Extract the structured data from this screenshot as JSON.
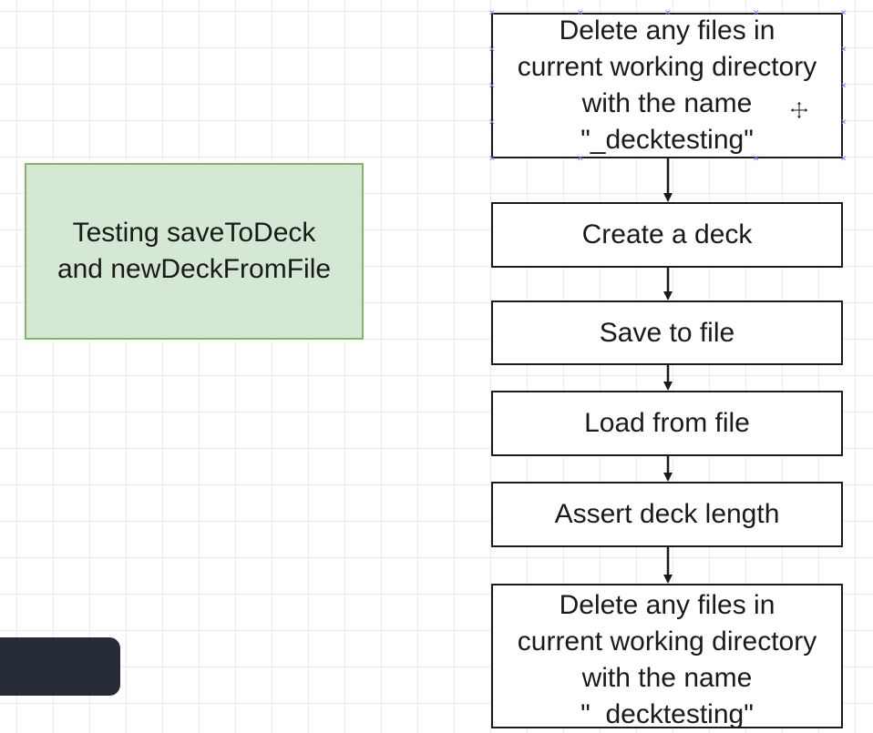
{
  "note": {
    "text": "Testing saveToDeck\nand newDeckFromFile"
  },
  "steps": [
    "Delete any files in\ncurrent working directory\nwith the name\n\"_decktesting\"",
    "Create a deck",
    "Save to file",
    "Load from file",
    "Assert deck length",
    "Delete any files in\ncurrent working directory\nwith the name\n\"_decktesting\""
  ],
  "colors": {
    "note_fill": "#d5e8d4",
    "note_border": "#82b366",
    "stroke": "#1a1a1a",
    "selection_handle": "#7c83f0",
    "panel": "#262d38"
  },
  "icons": {
    "cursor": "move-cursor-icon",
    "handle": "selection-handle-icon"
  }
}
